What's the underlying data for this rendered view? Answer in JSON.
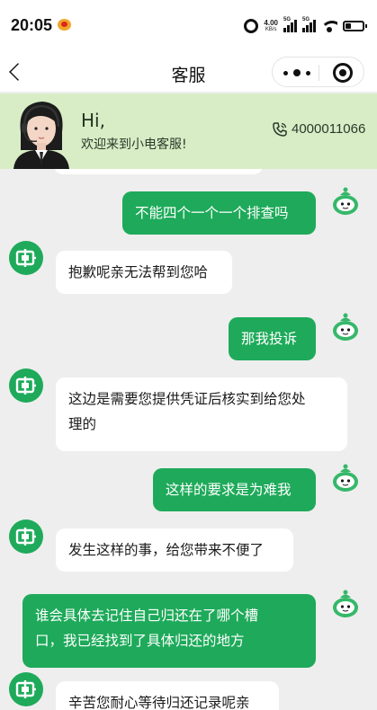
{
  "status_bar": {
    "time": "20:05",
    "net_speed_value": "4.00",
    "net_speed_unit": "KB/s",
    "signal_tag_1": "5G",
    "signal_tag_2": "5G",
    "icons": [
      "weibo-icon",
      "alarm-icon",
      "signal-icon",
      "signal-icon",
      "wifi-icon",
      "battery-icon"
    ]
  },
  "nav": {
    "title": "客服",
    "icons": [
      "back-icon",
      "more-icon",
      "close-circle-icon"
    ]
  },
  "banner": {
    "greeting": "Hi,",
    "welcome": "欢迎来到小电客服!",
    "phone": "4000011066",
    "background": "#d8edc6"
  },
  "messages": [
    {
      "side": "out",
      "text": "不能四个一个一个排查吗"
    },
    {
      "side": "in",
      "text": "抱歉呢亲无法帮到您哈"
    },
    {
      "side": "out",
      "text": "那我投诉"
    },
    {
      "side": "in",
      "line1": "这边是需要您提供凭证后核实到给您处",
      "line2": "理的"
    },
    {
      "side": "out",
      "text": "这样的要求是为难我"
    },
    {
      "side": "in",
      "text": "发生这样的事，给您带来不便了"
    },
    {
      "side": "out",
      "line1": "谁会具体去记住自己归还在了哪个槽",
      "line2": "口，我已经找到了具体归还的地方"
    },
    {
      "side": "in",
      "text": "辛苦您耐心等待归还记录呢亲"
    }
  ],
  "colors": {
    "outgoing_bubble": "#1eaa5a",
    "incoming_bubble": "#ffffff",
    "chat_background": "#eeeeee",
    "accent": "#1eaa5a"
  }
}
